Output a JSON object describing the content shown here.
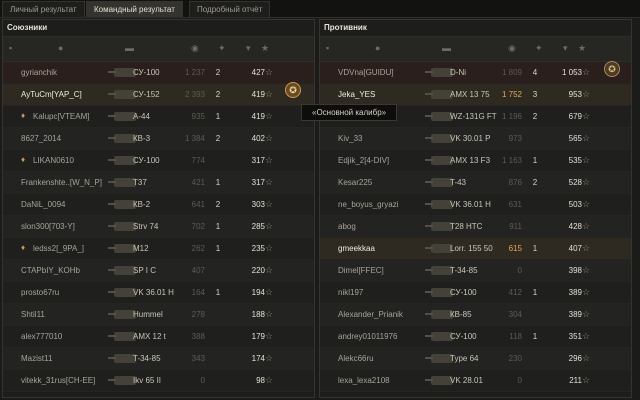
{
  "tabs": [
    {
      "label": "Личный результат"
    },
    {
      "label": "Командный результат"
    },
    {
      "label": "Подробный отчёт"
    }
  ],
  "allies_title": "Союзники",
  "enemies_title": "Противник",
  "tooltip": "«Основной калибр»",
  "allies": [
    {
      "name": "gyrianchik",
      "platoon": "",
      "vehicle": "СУ-100",
      "v1": "1 237",
      "v2": "2",
      "xp": "427"
    },
    {
      "name": "AyTuCm[YAP_C]",
      "platoon": "",
      "vehicle": "СУ-152",
      "v1": "2 393",
      "v2": "2",
      "xp": "419"
    },
    {
      "name": "Kalupc[VTEAM]",
      "platoon": "♦",
      "vehicle": "A-44",
      "v1": "935",
      "v2": "1",
      "xp": "419"
    },
    {
      "name": "8627_2014",
      "platoon": "",
      "vehicle": "КВ-3",
      "v1": "1 384",
      "v2": "2",
      "xp": "402"
    },
    {
      "name": "LIKAN0610",
      "platoon": "♦",
      "vehicle": "СУ-100",
      "v1": "774",
      "v2": "",
      "xp": "317"
    },
    {
      "name": "Frankenshte..[W_N_P]",
      "platoon": "",
      "vehicle": "T37",
      "v1": "421",
      "v2": "1",
      "xp": "317"
    },
    {
      "name": "DaNiL_0094",
      "platoon": "",
      "vehicle": "КВ-2",
      "v1": "641",
      "v2": "2",
      "xp": "303"
    },
    {
      "name": "slon300[703-Y]",
      "platoon": "",
      "vehicle": "Strv 74",
      "v1": "702",
      "v2": "1",
      "xp": "285"
    },
    {
      "name": "ledss2[_9PA_]",
      "platoon": "♦",
      "vehicle": "M12",
      "v1": "262",
      "v2": "1",
      "xp": "235"
    },
    {
      "name": "CTAPbIY_KOHb",
      "platoon": "",
      "vehicle": "SP I C",
      "v1": "407",
      "v2": "",
      "xp": "220"
    },
    {
      "name": "prosto67ru",
      "platoon": "",
      "vehicle": "VK 36.01 H",
      "v1": "164",
      "v2": "1",
      "xp": "194"
    },
    {
      "name": "Shtil11",
      "platoon": "",
      "vehicle": "Hummel",
      "v1": "278",
      "v2": "",
      "xp": "188"
    },
    {
      "name": "alex777010",
      "platoon": "",
      "vehicle": "AMX 12 t",
      "v1": "388",
      "v2": "",
      "xp": "179"
    },
    {
      "name": "Mazist11",
      "platoon": "",
      "vehicle": "T-34-85",
      "v1": "343",
      "v2": "",
      "xp": "174"
    },
    {
      "name": "vitekk_31rus[CH-EE]",
      "platoon": "",
      "vehicle": "Ikv 65 II",
      "v1": "0",
      "v2": "",
      "xp": "98"
    }
  ],
  "enemies": [
    {
      "name": "VDVna[GUIDU]",
      "vehicle": "D-Ni",
      "v1": "1 809",
      "v2": "4",
      "xp": "1 053"
    },
    {
      "name": "Jeka_YES",
      "vehicle": "AMX 13 75",
      "v1": "1 752",
      "v2": "3",
      "xp": "953"
    },
    {
      "name": "...411",
      "vehicle": "WZ-131G FT",
      "v1": "1 196",
      "v2": "2",
      "xp": "679"
    },
    {
      "name": "Kiv_33",
      "vehicle": "VK 30.01 P",
      "v1": "973",
      "v2": "",
      "xp": "565"
    },
    {
      "name": "Edjik_2[4-DIV]",
      "vehicle": "AMX 13 F3",
      "v1": "1 163",
      "v2": "1",
      "xp": "535"
    },
    {
      "name": "Kesar225",
      "vehicle": "T-43",
      "v1": "876",
      "v2": "2",
      "xp": "528"
    },
    {
      "name": "ne_boyus_gryazi",
      "vehicle": "VK 36.01 H",
      "v1": "631",
      "v2": "",
      "xp": "503"
    },
    {
      "name": "abog",
      "vehicle": "T28 HTC",
      "v1": "911",
      "v2": "",
      "xp": "428"
    },
    {
      "name": "gmeekkaa",
      "vehicle": "Lorr. 155 50",
      "v1": "615",
      "v2": "1",
      "xp": "407"
    },
    {
      "name": "Dimel[FFEC]",
      "vehicle": "T-34-85",
      "v1": "0",
      "v2": "",
      "xp": "398"
    },
    {
      "name": "nikl197",
      "vehicle": "СУ-100",
      "v1": "412",
      "v2": "1",
      "xp": "389"
    },
    {
      "name": "Alexander_Prianik",
      "vehicle": "КВ-85",
      "v1": "304",
      "v2": "",
      "xp": "389"
    },
    {
      "name": "andrey01011976",
      "vehicle": "СУ-100",
      "v1": "118",
      "v2": "1",
      "xp": "351"
    },
    {
      "name": "Alekc66ru",
      "vehicle": "Type 64",
      "v1": "230",
      "v2": "",
      "xp": "296"
    },
    {
      "name": "lexa_lexa2108",
      "vehicle": "VK 28.01",
      "v1": "0",
      "v2": "",
      "xp": "211"
    }
  ]
}
